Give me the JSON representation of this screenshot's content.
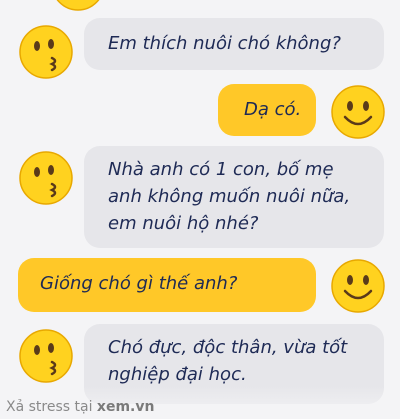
{
  "messages": [
    {
      "side": "left",
      "avatar": "kissing-face-icon",
      "text": "Em thích nuôi chó không?"
    },
    {
      "side": "right",
      "avatar": "smiling-face-icon",
      "text": "Dạ có."
    },
    {
      "side": "left",
      "avatar": "kissing-face-icon",
      "lines": [
        "Nhà anh có 1 con, bố mẹ",
        "anh không muốn nuôi nữa,",
        "em nuôi hộ nhé?"
      ]
    },
    {
      "side": "right",
      "avatar": "smiling-face-icon",
      "text": "Giống chó gì thế anh?"
    },
    {
      "side": "left",
      "avatar": "kissing-face-icon",
      "lines": [
        "Chó đực, độc thân, vừa tốt",
        "nghiệp đại học."
      ]
    }
  ],
  "watermark": {
    "prefix": "Xả stress tại ",
    "site": "xem.vn"
  },
  "colors": {
    "incoming_bubble": "#e6e6ea",
    "outgoing_bubble": "#ffc828",
    "text": "#1e2a55",
    "background": "#f4f4f6"
  }
}
